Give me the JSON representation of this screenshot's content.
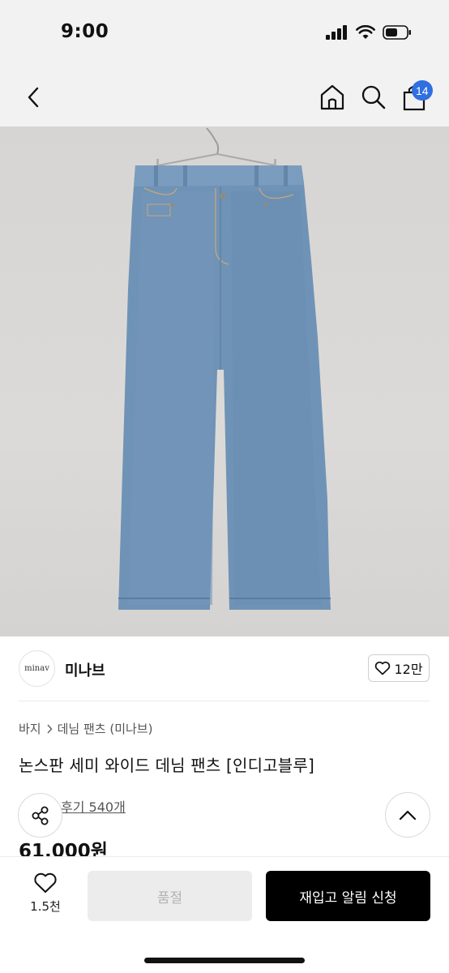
{
  "status_bar": {
    "time": "9:00"
  },
  "nav": {
    "cart_count": "14"
  },
  "brand": {
    "logo_text": "minav",
    "name": "미나브",
    "like_count": "12만"
  },
  "breadcrumb": {
    "category": "바지",
    "subcategory": "데님 팬츠 (미나브)"
  },
  "product": {
    "title": "논스판 세미 와이드 데님 팬츠 [인디고블루]",
    "review_label": "후기 540개",
    "price": "61,000원"
  },
  "bottom_bar": {
    "wish_count": "1.5천",
    "soldout_label": "품절",
    "restock_label": "재입고 알림 신청"
  },
  "colors": {
    "badge": "#2f6fe0",
    "primary_button": "#000000",
    "star": "#f5b400"
  }
}
